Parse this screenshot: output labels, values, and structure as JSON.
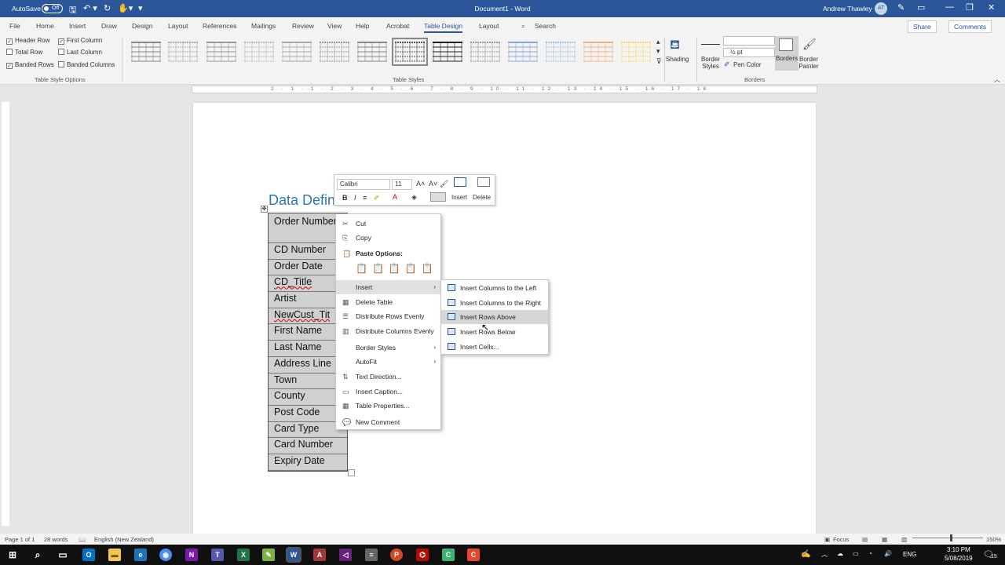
{
  "titlebar": {
    "autosave": "AutoSave",
    "toggle": "Off",
    "title": "Document1 - Word",
    "user": "Andrew Thawley",
    "initials": "AT"
  },
  "tabs": [
    "File",
    "Home",
    "Insert",
    "Draw",
    "Design",
    "Layout",
    "References",
    "Mailings",
    "Review",
    "View",
    "Help",
    "Acrobat",
    "Table Design",
    "Layout"
  ],
  "search": "Search",
  "share": "Share",
  "comments": "Comments",
  "style_options": {
    "header_row": "Header Row",
    "first_column": "First Column",
    "total_row": "Total Row",
    "last_column": "Last Column",
    "banded_rows": "Banded Rows",
    "banded_columns": "Banded Columns",
    "group": "Table Style Options"
  },
  "table_styles_group": "Table Styles",
  "shading": "Shading",
  "border_styles": "Border Styles",
  "pen_weight": "½ pt",
  "pen_color": "Pen Color",
  "borders": "Borders",
  "border_painter": "Border Painter",
  "borders_group": "Borders",
  "heading": "Data Defin",
  "rows": [
    "Order Number",
    "CD Number",
    "Order Date",
    "CD_Title",
    "Artist",
    "NewCust_Tit",
    "First Name",
    "Last Name",
    "Address Line",
    "Town",
    "County",
    "Post Code",
    "Card Type",
    "Card Number",
    "Expiry Date"
  ],
  "mini": {
    "font": "Calibri",
    "size": "11",
    "insert": "Insert",
    "delete": "Delete"
  },
  "menu": {
    "cut": "Cut",
    "copy": "Copy",
    "paste": "Paste Options:",
    "insert": "Insert",
    "delete_table": "Delete Table",
    "dist_rows": "Distribute Rows Evenly",
    "dist_cols": "Distribute Columns Evenly",
    "border_styles": "Border Styles",
    "autofit": "AutoFit",
    "text_dir": "Text Direction...",
    "caption": "Insert Caption...",
    "props": "Table Properties...",
    "comment": "New Comment"
  },
  "submenu": [
    "Insert Columns to the Left",
    "Insert Columns to the Right",
    "Insert Rows Above",
    "Insert Rows Below",
    "Insert Cells..."
  ],
  "status": {
    "page": "Page 1 of 1",
    "words": "28 words",
    "lang": "English (New Zealand)",
    "focus": "Focus",
    "zoom": "150%"
  },
  "taskbar": {
    "time": "3:10 PM",
    "date": "5/08/2019",
    "lang": "ENG",
    "badge": "15"
  }
}
